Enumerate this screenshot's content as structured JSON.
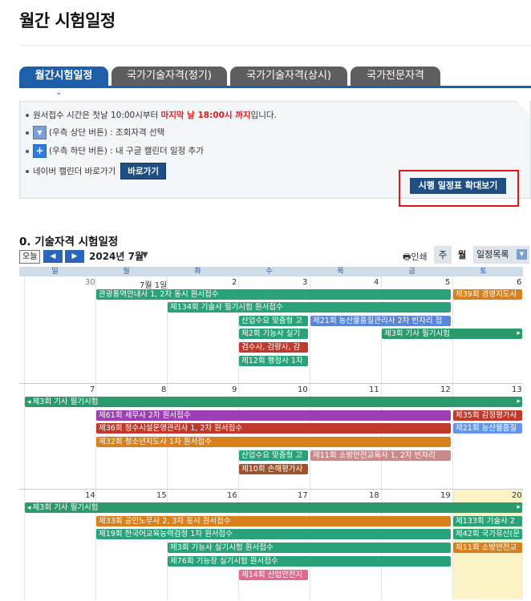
{
  "page": {
    "title": "월간 시험일정"
  },
  "tabs": [
    {
      "label": "월간시험일정",
      "active": true
    },
    {
      "label": "국가기술자격(정기)"
    },
    {
      "label": "국가기술자격(상시)"
    },
    {
      "label": "국가전문자격"
    }
  ],
  "notice": {
    "line1_pre": "원서접수 시간은 첫날 10:00시부터 ",
    "line1_red": "마지막 날 18:00시 까지",
    "line1_post": "입니다.",
    "line2": "(우측 상단 버튼) : 조회자격 선택",
    "line3": "(우측 하단 버튼) : 내 구글 캘린더 일정 추가",
    "line4": "네이버 캘린더 바로가기",
    "naver_button": "바로가기",
    "expand_button": "시행 일정표 확대보기"
  },
  "calendar": {
    "section_title": "0. 기술자격 시험일정",
    "today_label": "오늘",
    "month_label": "2024년 7월",
    "print_label": "인쇄",
    "view_week": "주",
    "view_month": "월",
    "view_agenda": "일정목록",
    "weekdays": [
      "일",
      "월",
      "화",
      "수",
      "목",
      "금",
      "토"
    ],
    "weeks": [
      {
        "days": [
          "30",
          "7월 1일",
          "2",
          "3",
          "4",
          "5",
          "6"
        ],
        "events": [
          {
            "label": "관광통역안내사 1, 2차 동시 원서접수"
          },
          {
            "label": "제39회 경영지도사"
          },
          {
            "label": "제134회 기술사 필기시험 원서접수"
          },
          {
            "label": "산업수요 맞춤형 고"
          },
          {
            "label": "제21회 농산물품질관리사 2차 빈자리 접"
          },
          {
            "label": "제2회 기능사 실기"
          },
          {
            "label": "제3회 기사 필기시험"
          },
          {
            "label": "검수사, 검량사, 감"
          },
          {
            "label": "제12회 행정사 1차"
          }
        ]
      },
      {
        "days": [
          "7",
          "8",
          "9",
          "10",
          "11",
          "12",
          "13"
        ],
        "events": [
          {
            "label": "제3회 기사 필기시험"
          },
          {
            "label": "제61회 세무사 2차 원서접수"
          },
          {
            "label": "제35회 감정평가사"
          },
          {
            "label": "제36회 정수시설운영관리사 1, 2차 원서접수"
          },
          {
            "label": "제21회 농산물품질"
          },
          {
            "label": "제32회 청소년지도사 1차 원서접수"
          },
          {
            "label": "산업수요 맞춤형 고"
          },
          {
            "label": "제11회 소방안전교육사 1, 2차 빈자리"
          },
          {
            "label": "제10회 손해평가사"
          }
        ]
      },
      {
        "days": [
          "14",
          "15",
          "16",
          "17",
          "18",
          "19",
          "20"
        ],
        "events": [
          {
            "label": "제3회 기사 필기시험"
          },
          {
            "label": "제33회 공인노무사 2, 3차 동시 원서접수"
          },
          {
            "label": "제133회 기술사 2"
          },
          {
            "label": "제19회 한국어교육능력검정 1차 원서접수"
          },
          {
            "label": "제42회 국가유산(문"
          },
          {
            "label": "제3회 기능사 실기시험 원서접수"
          },
          {
            "label": "제11회 소방안전교"
          },
          {
            "label": "제76회 기능장 실기시험 원서접수"
          },
          {
            "label": "제14회 산업안전지"
          }
        ]
      }
    ]
  }
}
